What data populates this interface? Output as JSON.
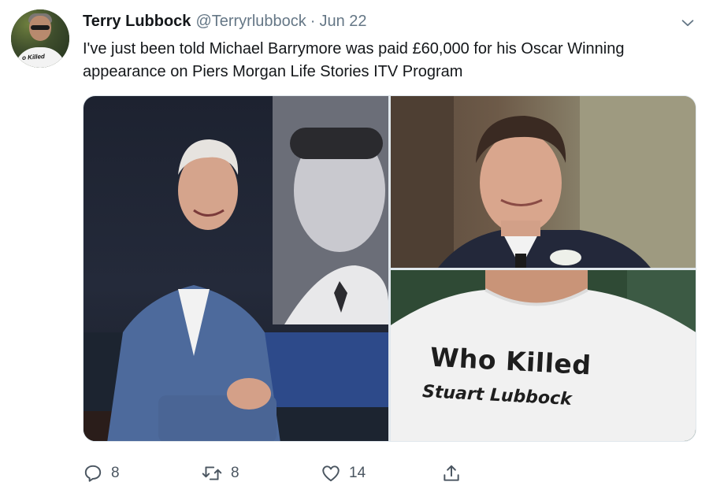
{
  "tweet": {
    "author_name": "Terry Lubbock",
    "handle": "@Terryrlubbock",
    "separator": "·",
    "date": "Jun 22",
    "text": "I've just been told Michael Barrymore was paid £60,000 for his Oscar Winning appearance on Piers Morgan Life Stories ITV Program",
    "avatar_shirt_text": "o Killed"
  },
  "media": {
    "images": [
      {
        "description_icon": "photo",
        "subject": "man-in-blue-suit-studio"
      },
      {
        "description_icon": "photo",
        "subject": "young-man-in-suit"
      },
      {
        "description_icon": "photo",
        "subject": "tshirt-slogan"
      }
    ],
    "tshirt_line1": "Who Killed",
    "tshirt_line2": "Stuart Lubbock"
  },
  "actions": {
    "reply_count": "8",
    "retweet_count": "8",
    "like_count": "14"
  },
  "icons": {
    "reply": "reply-icon",
    "retweet": "retweet-icon",
    "like": "heart-icon",
    "share": "share-icon",
    "menu": "chevron-down-icon"
  },
  "colors": {
    "text": "#14171a",
    "muted": "#657786",
    "border": "#e1e8ed"
  }
}
